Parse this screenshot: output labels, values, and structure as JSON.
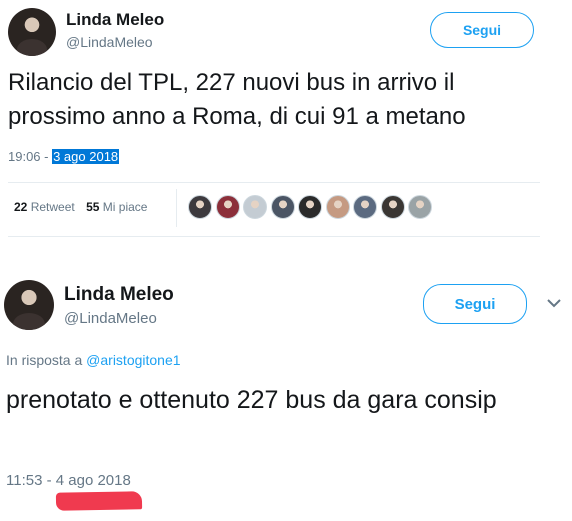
{
  "tweets": [
    {
      "author": {
        "name": "Linda Meleo",
        "handle": "@LindaMeleo"
      },
      "follow_label": "Segui",
      "text": "Rilancio del TPL, 227 nuovi bus in arrivo il prossimo anno a Roma, di cui 91 a metano",
      "time": "19:06 - ",
      "date": "3 ago 2018",
      "date_selected": true,
      "stats": {
        "retweets": "22",
        "retweets_label": "Retweet",
        "likes": "55",
        "likes_label": "Mi piace"
      },
      "likers": [
        {
          "icon": "liker-avatar",
          "color": "#3d3a3e"
        },
        {
          "icon": "liker-avatar",
          "color": "#8c2f3a"
        },
        {
          "icon": "default-avatar",
          "color": "#c4ccd3"
        },
        {
          "icon": "liker-avatar",
          "color": "#4b5564"
        },
        {
          "icon": "liker-avatar",
          "color": "#2a2a2a"
        },
        {
          "icon": "liker-avatar",
          "color": "#c59a82"
        },
        {
          "icon": "liker-avatar",
          "color": "#5b6a80"
        },
        {
          "icon": "liker-avatar",
          "color": "#3a3633"
        },
        {
          "icon": "liker-avatar",
          "color": "#9aa3a6"
        }
      ]
    },
    {
      "author": {
        "name": "Linda Meleo",
        "handle": "@LindaMeleo"
      },
      "follow_label": "Segui",
      "reply_prefix": "In risposta a ",
      "reply_mention": "@aristogitone1",
      "text": "prenotato e ottenuto 227 bus da gara consip",
      "time": "11:53 - ",
      "date": "4 ago 2018"
    }
  ],
  "colors": {
    "accent": "#1da1f2",
    "secondary_text": "#657786",
    "selection": "#0078d7",
    "redaction": "#f03a4f"
  },
  "icons": {
    "menu": "chevron-down-icon"
  }
}
